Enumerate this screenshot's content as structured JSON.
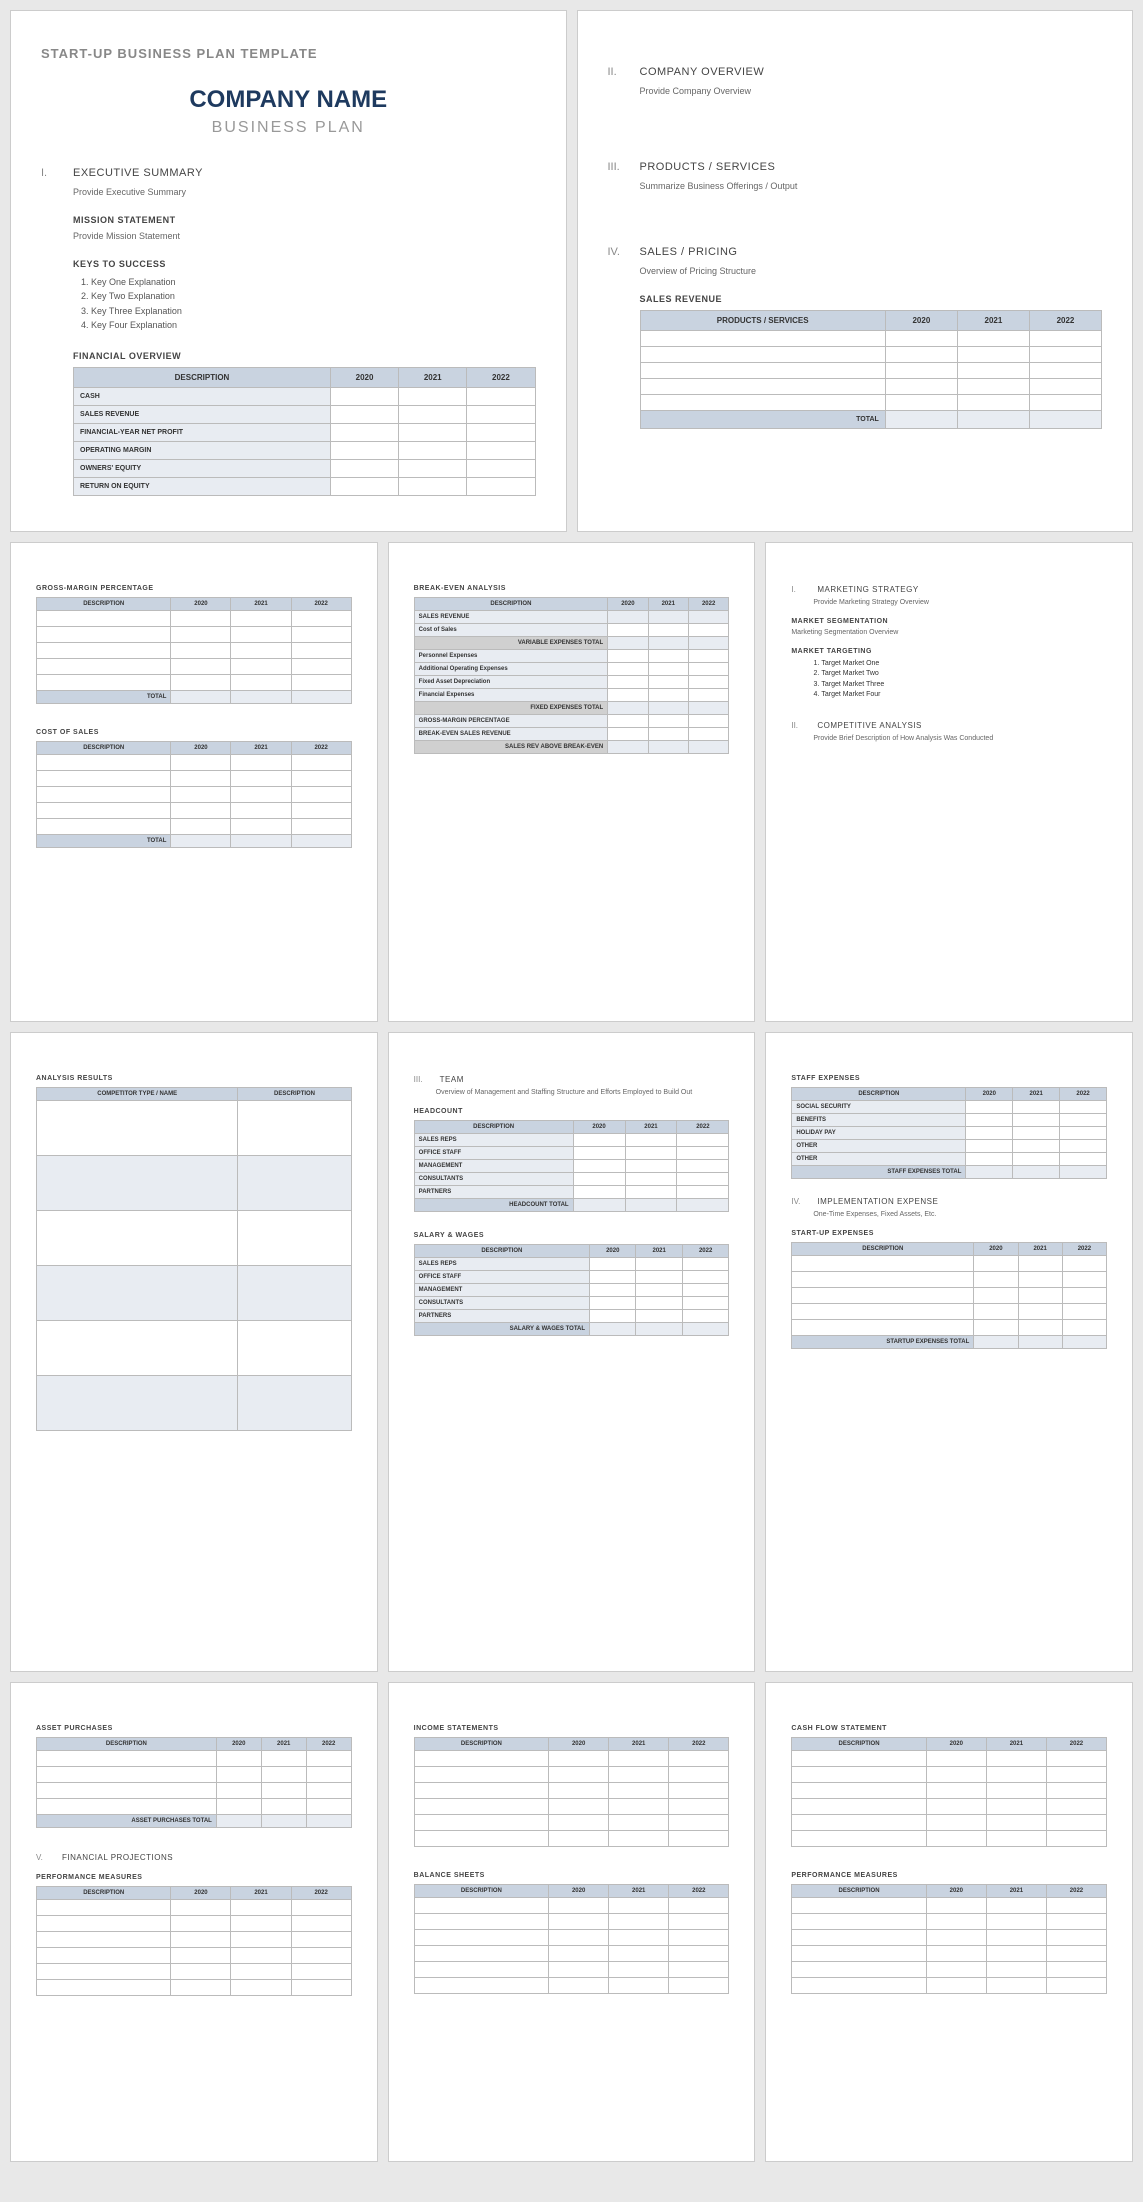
{
  "template_title": "START-UP BUSINESS PLAN TEMPLATE",
  "company_name": "COMPANY NAME",
  "business_plan": "BUSINESS PLAN",
  "sections": {
    "exec": {
      "num": "I.",
      "title": "EXECUTIVE SUMMARY",
      "body": "Provide Executive Summary"
    },
    "mission": {
      "title": "MISSION STATEMENT",
      "body": "Provide Mission Statement"
    },
    "keys": {
      "title": "KEYS TO SUCCESS",
      "items": [
        "Key One Explanation",
        "Key Two Explanation",
        "Key Three Explanation",
        "Key Four Explanation"
      ]
    },
    "fin_overview": {
      "title": "FINANCIAL OVERVIEW"
    },
    "company": {
      "num": "II.",
      "title": "COMPANY OVERVIEW",
      "body": "Provide Company Overview"
    },
    "products": {
      "num": "III.",
      "title": "PRODUCTS / SERVICES",
      "body": "Summarize Business Offerings / Output"
    },
    "sales": {
      "num": "IV.",
      "title": "SALES / PRICING",
      "body": "Overview of Pricing Structure"
    },
    "sales_rev": {
      "title": "SALES REVENUE"
    },
    "gross_margin": {
      "title": "GROSS-MARGIN PERCENTAGE"
    },
    "cost_sales": {
      "title": "COST OF SALES"
    },
    "break_even": {
      "title": "BREAK-EVEN ANALYSIS"
    },
    "marketing": {
      "num": "I.",
      "title": "MARKETING STRATEGY",
      "body": "Provide Marketing Strategy Overview"
    },
    "segmentation": {
      "title": "MARKET SEGMENTATION",
      "body": "Marketing Segmentation Overview"
    },
    "targeting": {
      "title": "MARKET TARGETING",
      "items": [
        "Target Market One",
        "Target Market Two",
        "Target Market Three",
        "Target Market Four"
      ]
    },
    "competitive": {
      "num": "II.",
      "title": "COMPETITIVE ANALYSIS",
      "body": "Provide Brief Description of How Analysis Was Conducted"
    },
    "analysis_results": {
      "title": "ANALYSIS RESULTS"
    },
    "team": {
      "num": "III.",
      "title": "TEAM",
      "body": "Overview of Management and Staffing Structure and Efforts Employed to Build Out"
    },
    "headcount": {
      "title": "HEADCOUNT"
    },
    "salary": {
      "title": "SALARY & WAGES"
    },
    "staff_exp": {
      "title": "STAFF EXPENSES"
    },
    "impl_exp": {
      "num": "IV.",
      "title": "IMPLEMENTATION EXPENSE",
      "body": "One-Time Expenses, Fixed Assets, Etc."
    },
    "startup_exp": {
      "title": "START-UP EXPENSES"
    },
    "asset_purch": {
      "title": "ASSET PURCHASES"
    },
    "fin_proj": {
      "num": "V.",
      "title": "FINANCIAL PROJECTIONS"
    },
    "perf_measures": {
      "title": "PERFORMANCE MEASURES"
    },
    "income": {
      "title": "INCOME STATEMENTS"
    },
    "balance": {
      "title": "BALANCE SHEETS"
    },
    "cashflow": {
      "title": "CASH FLOW STATEMENT"
    }
  },
  "cols": {
    "desc": "DESCRIPTION",
    "y1": "2020",
    "y2": "2021",
    "y3": "2022",
    "prod": "PRODUCTS / SERVICES",
    "comp": "COMPETITOR TYPE / NAME"
  },
  "rows": {
    "fin_overview": [
      "CASH",
      "SALES REVENUE",
      "FINANCIAL-YEAR NET PROFIT",
      "OPERATING MARGIN",
      "OWNERS' EQUITY",
      "RETURN ON EQUITY"
    ],
    "break_even": {
      "sales_rev": "SALES REVENUE",
      "cost_sales": "Cost of Sales",
      "var_total": "VARIABLE EXPENSES TOTAL",
      "personnel": "Personnel Expenses",
      "add_op": "Additional Operating Expenses",
      "fixed_dep": "Fixed Asset Depreciation",
      "fin_exp": "Financial Expenses",
      "fixed_total": "FIXED EXPENSES TOTAL",
      "gross_pct": "GROSS-MARGIN PERCENTAGE",
      "be_sales": "BREAK-EVEN SALES REVENUE",
      "above_be": "SALES REV ABOVE BREAK-EVEN"
    },
    "headcount": [
      "SALES REPS",
      "OFFICE STAFF",
      "MANAGEMENT",
      "CONSULTANTS",
      "PARTNERS"
    ],
    "staff_exp": [
      "SOCIAL SECURITY",
      "BENEFITS",
      "HOLIDAY PAY",
      "OTHER",
      "OTHER"
    ]
  },
  "totals": {
    "total": "TOTAL",
    "headcount": "HEADCOUNT TOTAL",
    "salary": "SALARY & WAGES TOTAL",
    "staff": "STAFF EXPENSES TOTAL",
    "startup": "STARTUP EXPENSES TOTAL",
    "asset": "ASSET PURCHASES TOTAL"
  }
}
